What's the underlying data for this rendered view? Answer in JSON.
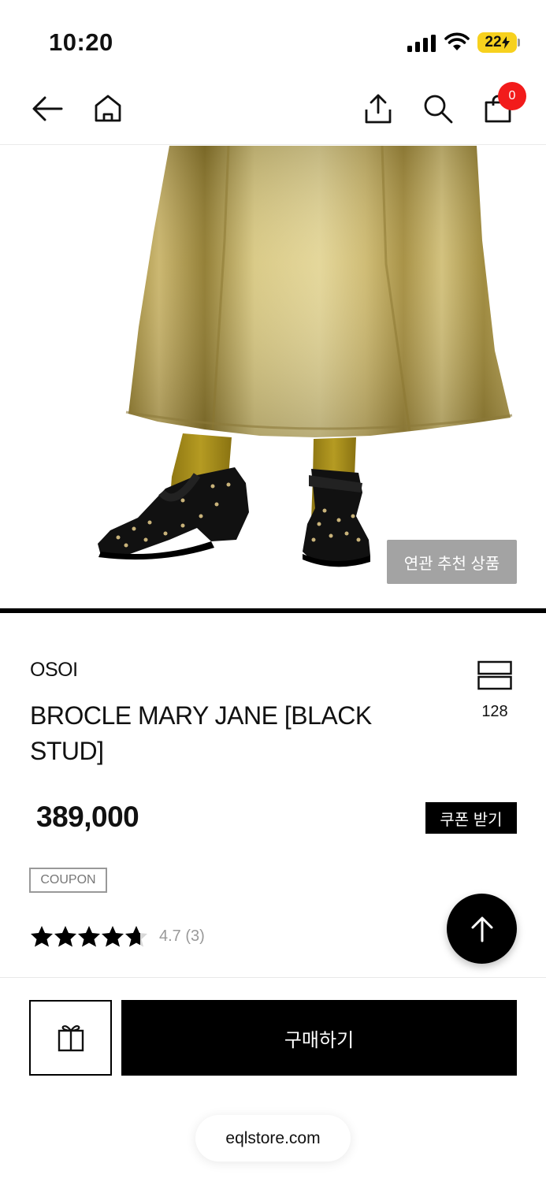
{
  "status": {
    "time": "10:20",
    "battery": "22"
  },
  "nav": {
    "cart_count": "0"
  },
  "hero": {
    "related_label": "연관 추천 상품"
  },
  "product": {
    "brand": "OSOI",
    "name": "BROCLE MARY JANE [BLACK STUD]",
    "wish_count": "128",
    "price": "389,000",
    "coupon_button": "쿠폰 받기",
    "coupon_tag": "COUPON",
    "rating": 4.7,
    "rating_text": "4.7 (3)"
  },
  "bottom": {
    "buy_label": "구매하기",
    "url": "eqlstore.com"
  },
  "colors": {
    "badge": "#f21b1b",
    "battery": "#f7d11e",
    "related_button": "#a3a3a3"
  },
  "icons": [
    "back-arrow-icon",
    "home-icon",
    "share-icon",
    "search-icon",
    "cart-icon",
    "wishlist-icon",
    "star-icon",
    "arrow-up-icon",
    "gift-icon"
  ]
}
